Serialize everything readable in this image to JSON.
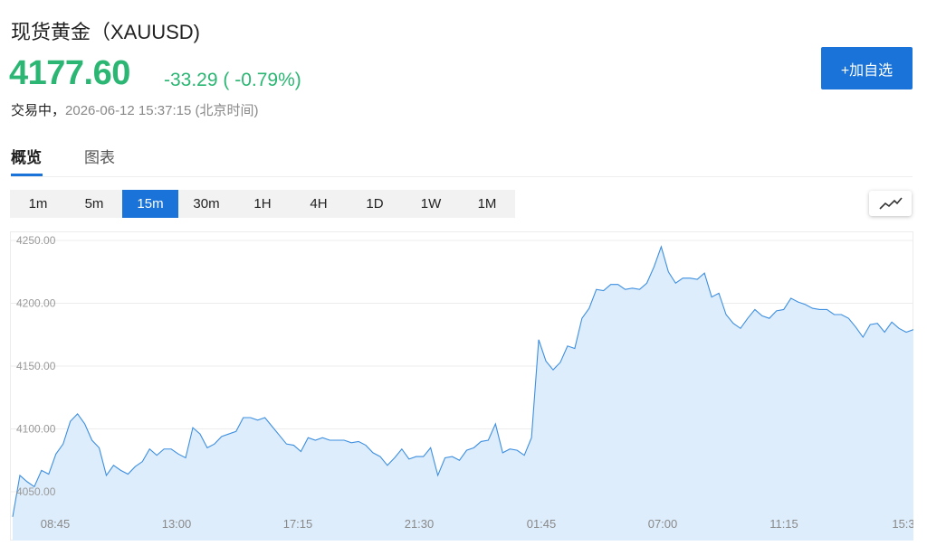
{
  "header": {
    "title": "现货黄金（XAUUSD)",
    "price": "4177.60",
    "change": "-33.29 ( -0.79%)",
    "status_label": "交易中，",
    "timestamp": "2026-06-12 15:37:15 (北京时间)",
    "add_button_label": "+加自选"
  },
  "tabs": [
    {
      "label": "概览",
      "active": true
    },
    {
      "label": "图表",
      "active": false
    }
  ],
  "periods": [
    {
      "label": "1m"
    },
    {
      "label": "5m"
    },
    {
      "label": "15m",
      "active": true
    },
    {
      "label": "30m"
    },
    {
      "label": "1H"
    },
    {
      "label": "4H"
    },
    {
      "label": "1D"
    },
    {
      "label": "1W"
    },
    {
      "label": "1M"
    }
  ],
  "chart_type_icon": "line-chart-icon",
  "colors": {
    "up_down_green": "#2bb673",
    "accent": "#1a73d9",
    "line": "#3d8fe0",
    "area": "#deedfc"
  },
  "chart_data": {
    "type": "area",
    "ylim": [
      4035,
      4260
    ],
    "y_ticks": [
      "4250.00",
      "4200.00",
      "4150.00",
      "4100.00",
      "4050.00"
    ],
    "y_tick_values": [
      4250,
      4200,
      4150,
      4100,
      4050
    ],
    "x_tick_labels": [
      "08:45",
      "13:00",
      "17:15",
      "21:30",
      "01:45",
      "07:00",
      "11:15",
      "15:3"
    ],
    "series": [
      {
        "values": [
          4030,
          4063,
          4058,
          4054,
          4067,
          4064,
          4080,
          4088,
          4106,
          4112,
          4104,
          4091,
          4085,
          4063,
          4071,
          4067,
          4064,
          4070,
          4074,
          4084,
          4079,
          4084,
          4084,
          4080,
          4077,
          4101,
          4096,
          4085,
          4088,
          4094,
          4096,
          4098,
          4109,
          4109,
          4107,
          4109,
          4102,
          4095,
          4088,
          4087,
          4082,
          4093,
          4091,
          4093,
          4091,
          4091,
          4091,
          4089,
          4090,
          4087,
          4081,
          4078,
          4071,
          4077,
          4084,
          4076,
          4078,
          4078,
          4085,
          4063,
          4077,
          4078,
          4075,
          4083,
          4085,
          4090,
          4091,
          4104,
          4081,
          4084,
          4083,
          4079,
          4093,
          4171,
          4154,
          4147,
          4153,
          4166,
          4164,
          4188,
          4196,
          4211,
          4210,
          4215,
          4215,
          4211,
          4212,
          4211,
          4216,
          4229,
          4245,
          4225,
          4216,
          4220,
          4220,
          4219,
          4224,
          4205,
          4208,
          4191,
          4184,
          4180,
          4188,
          4195,
          4190,
          4188,
          4194,
          4195,
          4204,
          4201,
          4199,
          4196,
          4195,
          4195,
          4191,
          4191,
          4188,
          4181,
          4173,
          4183,
          4184,
          4177,
          4185,
          4180,
          4177,
          4179
        ]
      }
    ]
  }
}
